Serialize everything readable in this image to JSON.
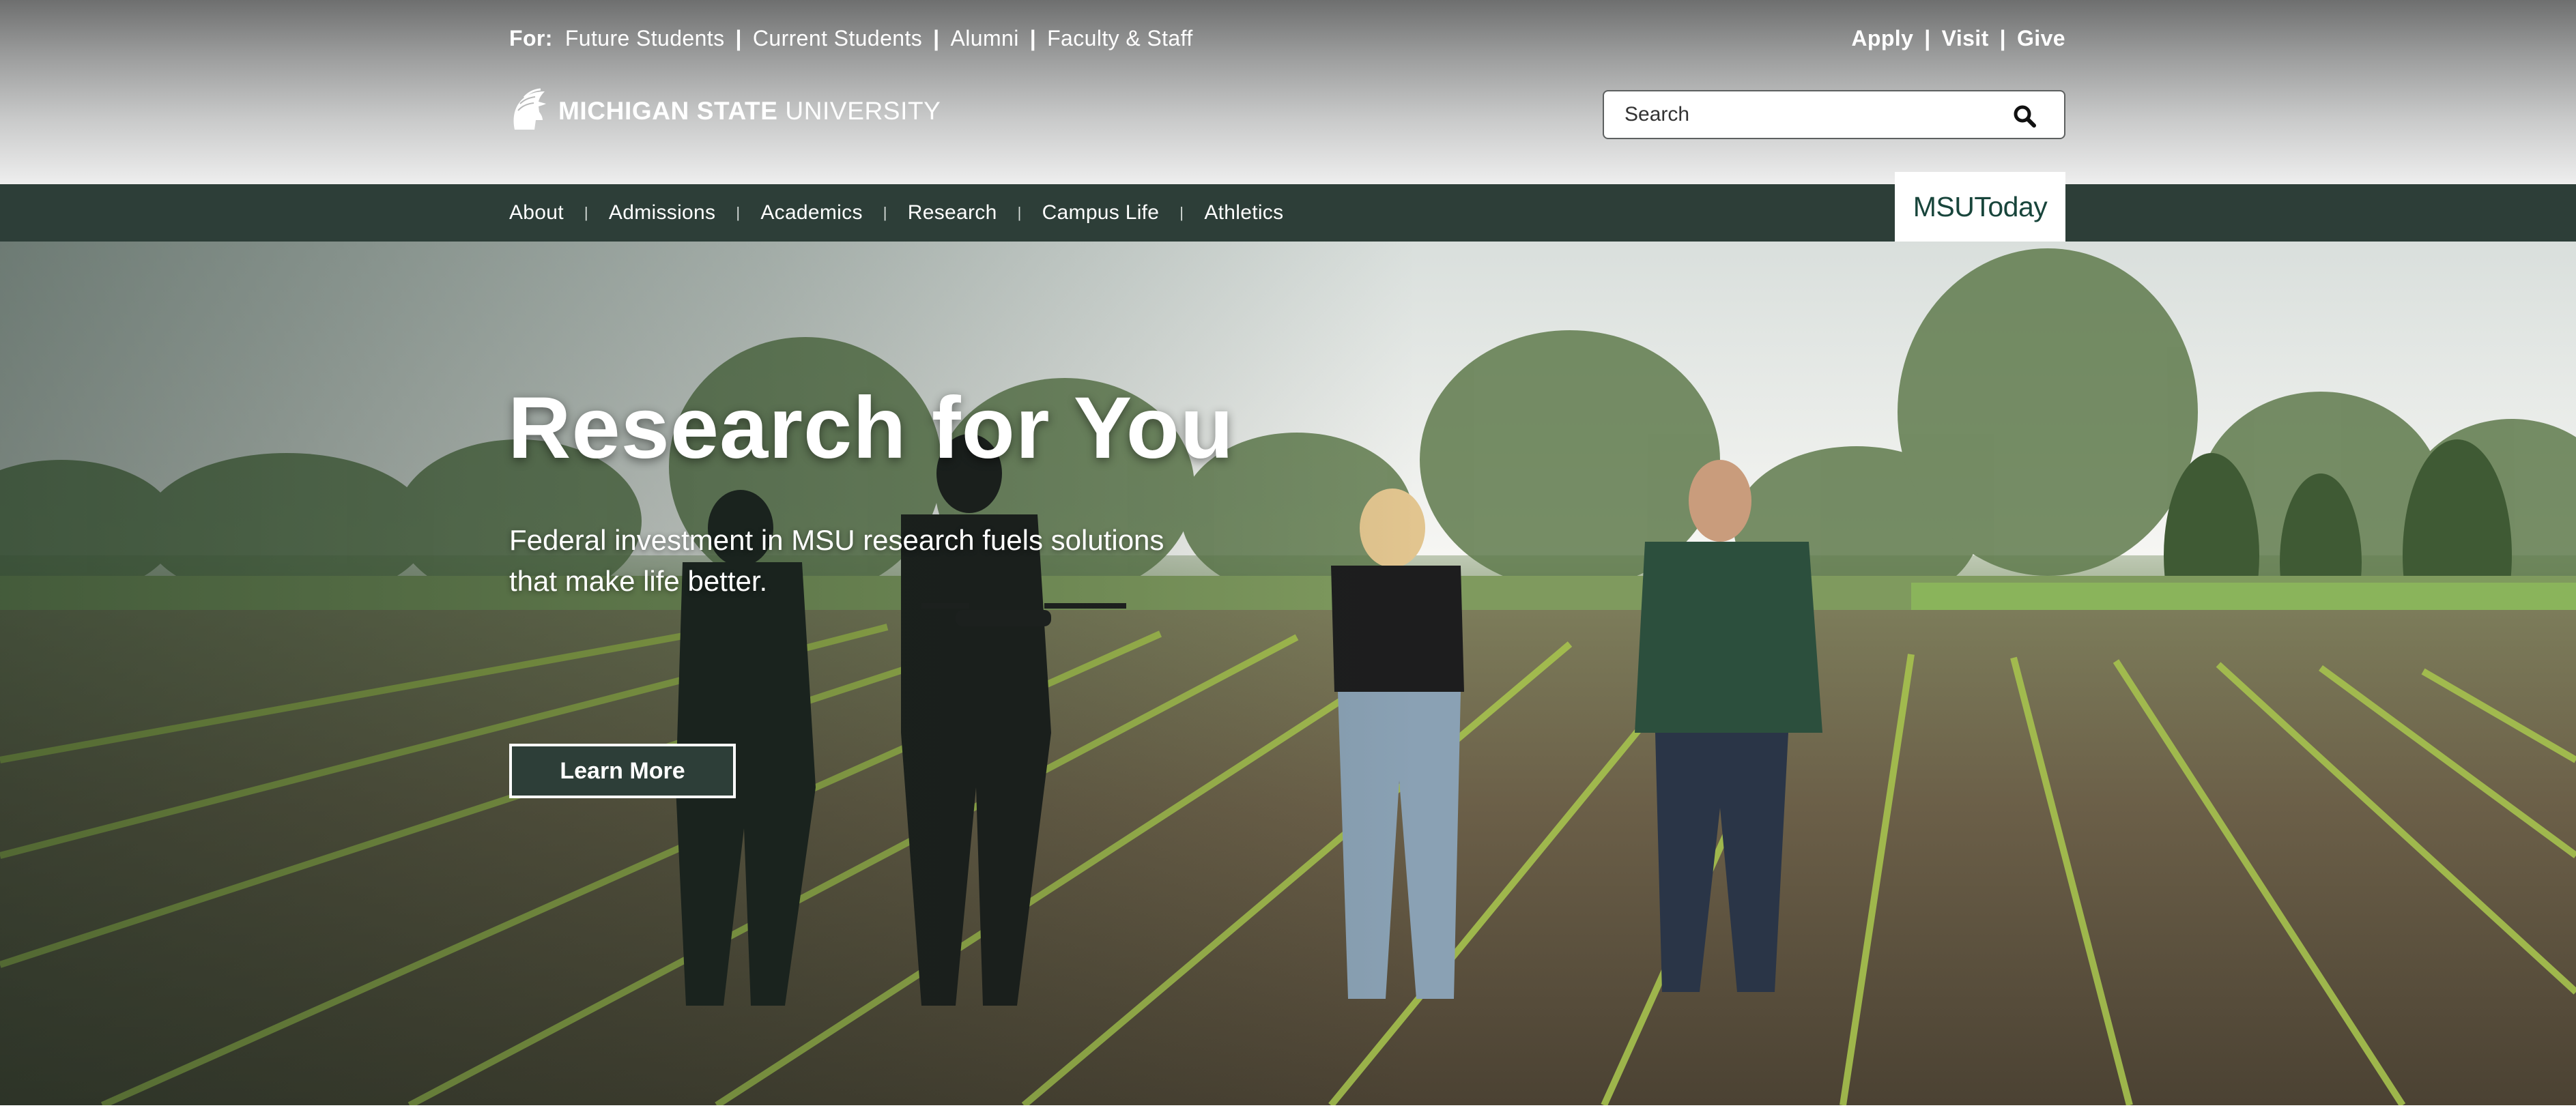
{
  "utility_nav": {
    "for_label": "For:",
    "audience_links": [
      "Future Students",
      "Current Students",
      "Alumni",
      "Faculty & Staff"
    ],
    "separator": "|",
    "action_links": [
      "Apply",
      "Visit",
      "Give"
    ]
  },
  "logo": {
    "bold_text": "MICHIGAN STATE",
    "light_text": "UNIVERSITY"
  },
  "search": {
    "placeholder": "Search",
    "value": "",
    "icon": "search-icon"
  },
  "main_nav": {
    "items": [
      "About",
      "Admissions",
      "Academics",
      "Research",
      "Campus Life",
      "Athletics"
    ],
    "separator": "|",
    "msutoday_label": "MSUToday"
  },
  "hero": {
    "title": "Research for You",
    "subtitle": "Federal investment in MSU research fuels solutions that make life better.",
    "button_label": "Learn More"
  },
  "colors": {
    "msu_green": "#18453b",
    "nav_background": "#2d3e38",
    "header_gradient_top": "#6e6f6f",
    "header_gradient_bottom": "#eeeeee"
  }
}
